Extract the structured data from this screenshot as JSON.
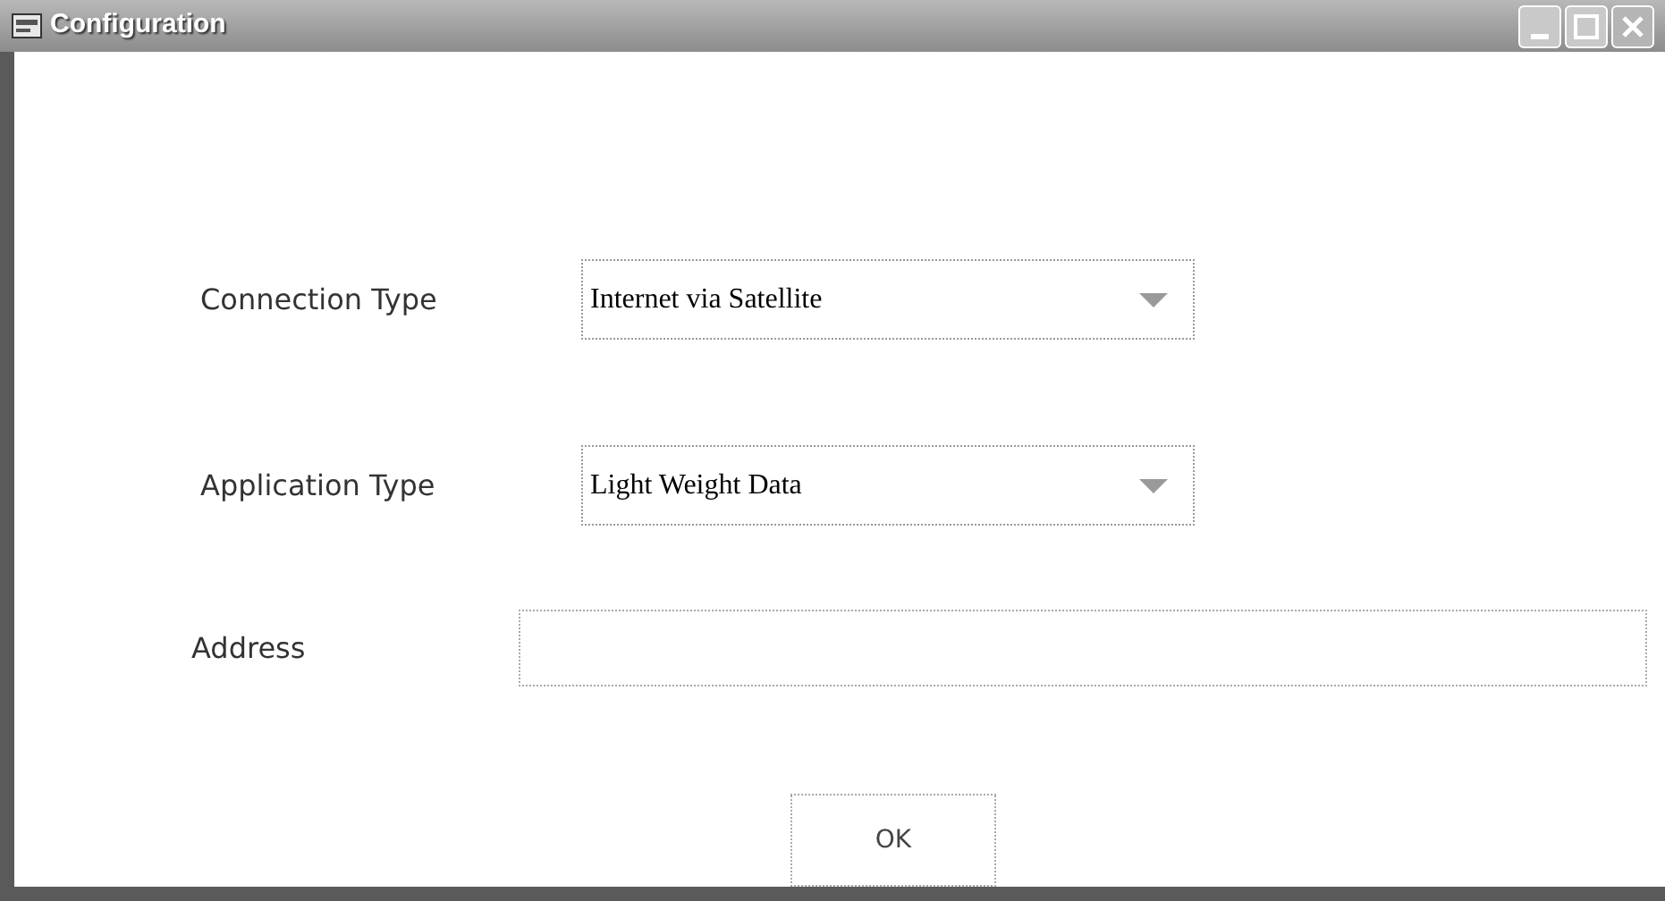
{
  "window": {
    "title": "Configuration"
  },
  "fields": [
    {
      "kind": "dropdown",
      "label": "Connection Type",
      "value": "Internet via Satellite"
    },
    {
      "kind": "dropdown",
      "label": "Application Type",
      "value": "Light Weight Data"
    },
    {
      "kind": "text",
      "label": "Address"
    }
  ],
  "buttons": [
    "OK"
  ]
}
